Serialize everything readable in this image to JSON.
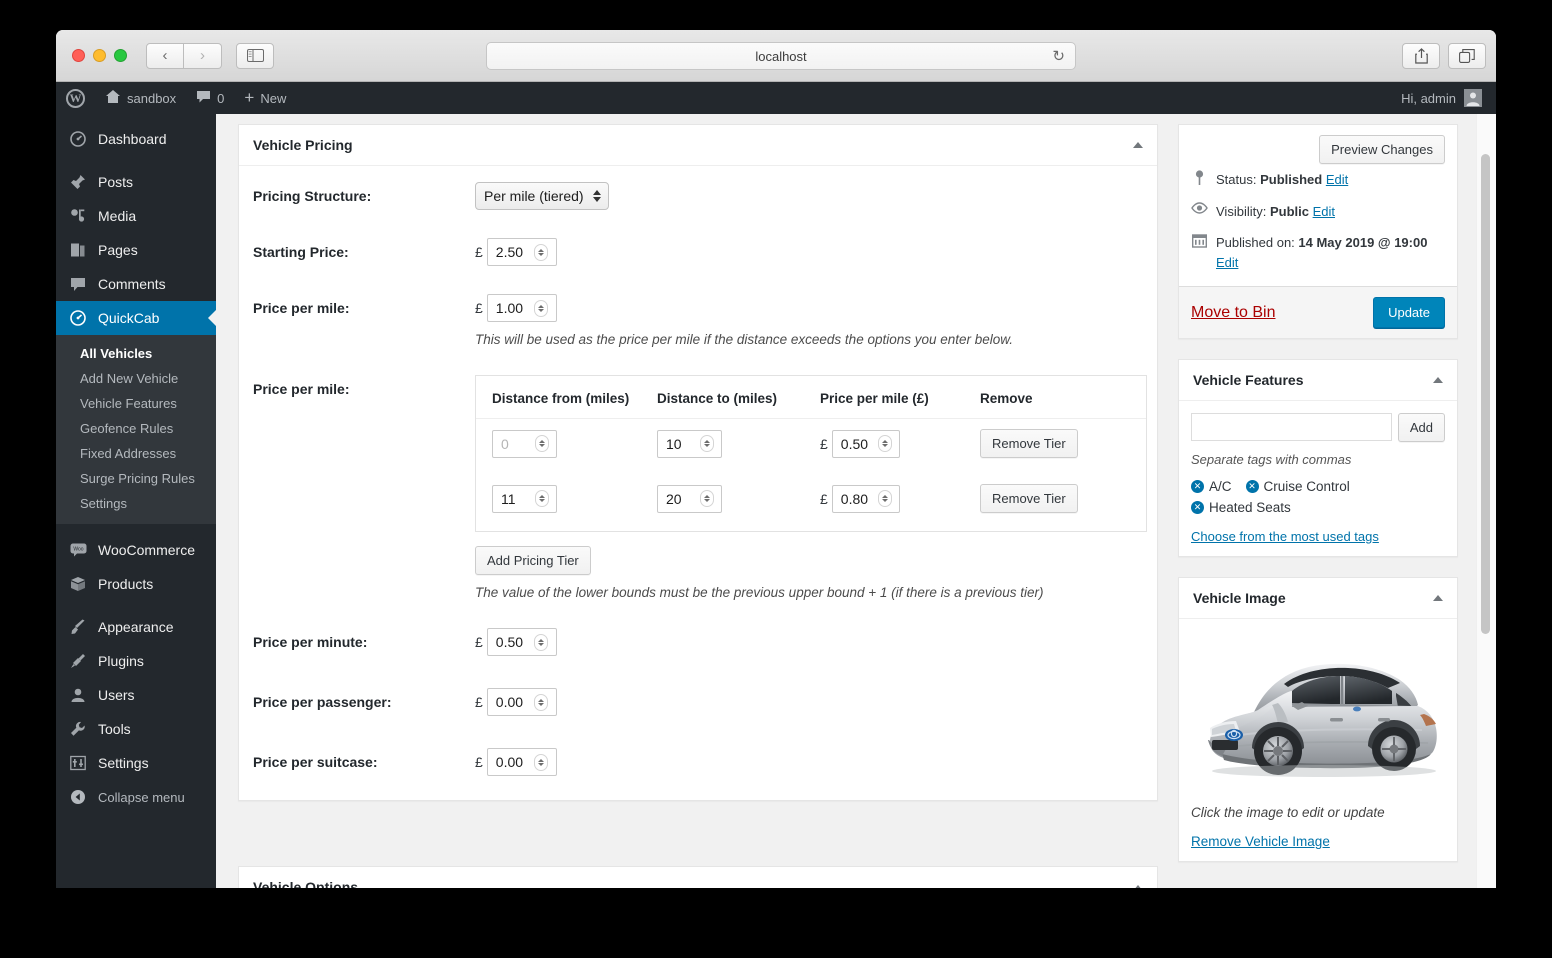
{
  "browser": {
    "url": "localhost",
    "back_icon": "chevron-left-icon",
    "forward_icon": "chevron-right-icon",
    "sidebar_icon": "sidebar-toggle-icon",
    "reload_icon": "reload-icon",
    "share_icon": "share-icon",
    "tabs_icon": "show-tabs-icon",
    "newtab_label": "+"
  },
  "adminbar": {
    "wp_logo": "wordpress-logo-icon",
    "site_name": "sandbox",
    "comments_icon": "comment-bubble-icon",
    "comments_count": "0",
    "new_plus": "+",
    "new_label": "New",
    "greeting": "Hi, admin"
  },
  "sidebar": {
    "items": [
      {
        "label": "Dashboard",
        "icon": "dashboard-icon",
        "current": false
      },
      {
        "label": "Posts",
        "icon": "pin-icon",
        "current": false
      },
      {
        "label": "Media",
        "icon": "media-icon",
        "current": false
      },
      {
        "label": "Pages",
        "icon": "pages-icon",
        "current": false
      },
      {
        "label": "Comments",
        "icon": "comment-bubble-icon",
        "current": false
      },
      {
        "label": "QuickCab",
        "icon": "dashboard-icon",
        "current": true
      }
    ],
    "submenu": [
      {
        "label": "All Vehicles",
        "current": true
      },
      {
        "label": "Add New Vehicle",
        "current": false
      },
      {
        "label": "Vehicle Features",
        "current": false
      },
      {
        "label": "Geofence Rules",
        "current": false
      },
      {
        "label": "Fixed Addresses",
        "current": false
      },
      {
        "label": "Surge Pricing Rules",
        "current": false
      },
      {
        "label": "Settings",
        "current": false
      }
    ],
    "items2": [
      {
        "label": "WooCommerce",
        "icon": "woo-icon"
      },
      {
        "label": "Products",
        "icon": "box-icon"
      }
    ],
    "items3": [
      {
        "label": "Appearance",
        "icon": "brush-icon"
      },
      {
        "label": "Plugins",
        "icon": "plug-icon"
      },
      {
        "label": "Users",
        "icon": "user-icon"
      },
      {
        "label": "Tools",
        "icon": "wrench-icon"
      },
      {
        "label": "Settings",
        "icon": "sliders-icon"
      }
    ],
    "collapse": {
      "label": "Collapse menu",
      "icon": "collapse-arrow-icon"
    }
  },
  "pricing_panel": {
    "title": "Vehicle Pricing",
    "toggle_icon": "chevron-up-icon",
    "structure": {
      "label": "Pricing Structure:",
      "value": "Per mile (tiered)",
      "options": [
        "Per mile (tiered)"
      ]
    },
    "starting_price": {
      "label": "Starting Price:",
      "currency": "£",
      "value": "2.50"
    },
    "price_per_mile": {
      "label": "Price per mile:",
      "currency": "£",
      "value": "1.00",
      "help": "This will be used as the price per mile if the distance exceeds the options you enter below."
    },
    "tier_section": {
      "label": "Price per mile:",
      "columns": [
        "Distance from (miles)",
        "Distance to (miles)",
        "Price per mile (£)",
        "Remove"
      ],
      "rows": [
        {
          "from": "",
          "from_placeholder": "0",
          "to": "10",
          "currency": "£",
          "price": "0.50",
          "remove_label": "Remove Tier"
        },
        {
          "from": "11",
          "from_placeholder": "0",
          "to": "20",
          "currency": "£",
          "price": "0.80",
          "remove_label": "Remove Tier"
        }
      ],
      "add_label": "Add Pricing Tier",
      "help": "The value of the lower bounds must be the previous upper bound + 1 (if there is a previous tier)"
    },
    "price_per_minute": {
      "label": "Price per minute:",
      "currency": "£",
      "value": "0.50"
    },
    "price_per_passenger": {
      "label": "Price per passenger:",
      "currency": "£",
      "value": "0.00"
    },
    "price_per_suitcase": {
      "label": "Price per suitcase:",
      "currency": "£",
      "value": "0.00"
    }
  },
  "next_panel": {
    "title": "Vehicle Options",
    "toggle_icon": "chevron-up-icon"
  },
  "publish_box": {
    "preview_label": "Preview Changes",
    "status_icon": "pin-icon",
    "status_label": "Status:",
    "status_value": "Published",
    "status_edit": "Edit",
    "visibility_icon": "eye-icon",
    "visibility_label": "Visibility:",
    "visibility_value": "Public",
    "visibility_edit": "Edit",
    "published_icon": "calendar-icon",
    "published_label": "Published on:",
    "published_value": "14 May 2019 @ 19:00",
    "published_edit": "Edit",
    "trash_label": "Move to Bin",
    "update_label": "Update"
  },
  "features_box": {
    "title": "Vehicle Features",
    "toggle_icon": "chevron-up-icon",
    "input_value": "",
    "add_label": "Add",
    "hint": "Separate tags with commas",
    "tags": [
      "A/C",
      "Cruise Control",
      "Heated Seats"
    ],
    "remove_icon": "remove-tag-icon",
    "choose_link": "Choose from the most used tags"
  },
  "image_box": {
    "title": "Vehicle Image",
    "toggle_icon": "chevron-up-icon",
    "image_alt": "silver-toyota-prius-photo",
    "caption": "Click the image to edit or update",
    "remove_link": "Remove Vehicle Image"
  },
  "colors": {
    "wp_blue": "#0073aa",
    "button_blue": "#0085ba",
    "admin_dark": "#23282d",
    "submenu_dark": "#32373c",
    "danger_red": "#a00"
  }
}
